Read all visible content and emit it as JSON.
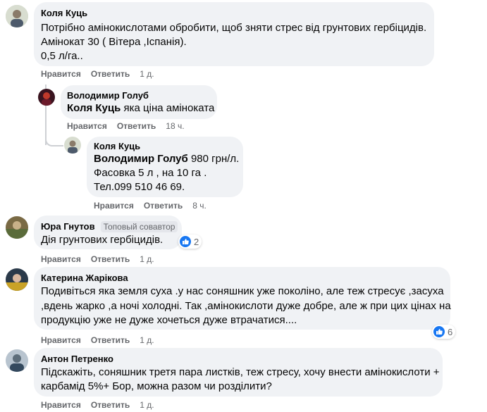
{
  "comments": [
    {
      "author": "Коля Куць",
      "lines": [
        "Потрібно амінокислотами обробити, щоб зняти стрес від грунтових гербіцидів.",
        "Амінокат 30 ( Вітера ,Іспанія).",
        "0,5 л/га.."
      ],
      "like_label": "Нравится",
      "reply_label": "Ответить",
      "time": "1 д."
    },
    {
      "author": "Володимир Голуб",
      "mention": "Коля Куць",
      "text": " яка ціна аміноката",
      "like_label": "Нравится",
      "reply_label": "Ответить",
      "time": "18 ч."
    },
    {
      "author": "Коля Куць",
      "mention": "Володимир Голуб",
      "text": " 980 грн/л.",
      "lines": [
        "Фасовка 5 л , на 10 га .",
        "Тел.099 510 46 69."
      ],
      "like_label": "Нравится",
      "reply_label": "Ответить",
      "time": "8 ч."
    },
    {
      "author": "Юра Гнутов",
      "badge": "Топовый совавтор",
      "text": "Дія грунтових гербіцидів.",
      "reactions": "2",
      "like_label": "Нравится",
      "reply_label": "Ответить",
      "time": "1 д."
    },
    {
      "author": "Катерина Жарікова",
      "lines": [
        "Подивіться яка земля суха .у нас соняшник уже поколіно, але теж стресує ,засуха",
        ",вдень жарко ,а ночі холодні. Так ,амінокислоти дуже добре, але ж при цих цінах на",
        "продукцію уже не дуже хочеться дуже втрачатися...."
      ],
      "reactions": "6",
      "like_label": "Нравится",
      "reply_label": "Ответить",
      "time": "1 д."
    },
    {
      "author": "Антон Петренко",
      "lines": [
        "Підскажіть, соняшник третя пара листків, теж стресу, хочу внести амінокислоти +",
        "карбамід 5%+ Бор, можна разом чи розділити?"
      ],
      "like_label": "Нравится",
      "reply_label": "Ответить",
      "time": "1 д."
    }
  ],
  "colors": {
    "bubble": "#f0f2f5",
    "meta": "#65676b",
    "like": "#1877f2"
  }
}
